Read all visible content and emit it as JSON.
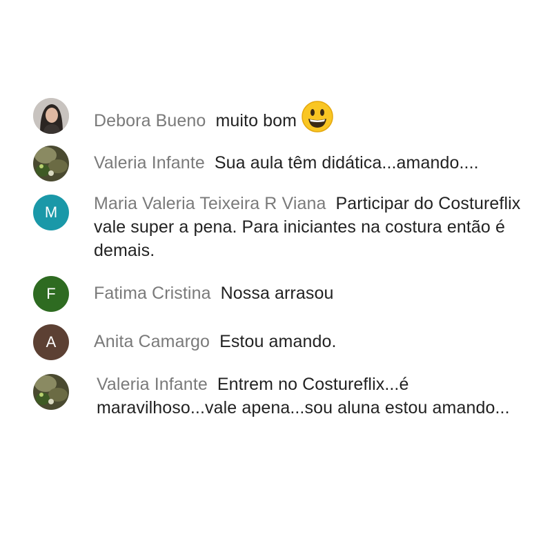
{
  "messages": [
    {
      "author": "Debora Bueno",
      "text": "muito bom",
      "emoji": "grinning-face-emoji"
    },
    {
      "author": "Valeria Infante",
      "text": "Sua aula têm didática...amando...."
    },
    {
      "author": "Maria Valeria Teixeira R Viana",
      "text": "Participar do Costureflix vale super a pena. Para iniciantes na costura então é demais.",
      "avatar_letter": "M",
      "avatar_color": "#1a98a8"
    },
    {
      "author": "Fatima Cristina",
      "text": "Nossa arrasou",
      "avatar_letter": "F",
      "avatar_color": "#2e6b21"
    },
    {
      "author": "Anita Camargo",
      "text": "Estou amando.",
      "avatar_letter": "A",
      "avatar_color": "#5c4033"
    },
    {
      "author": "Valeria Infante",
      "text": "Entrem no Costureflix...é maravilhoso...vale apena...sou aluna estou amando..."
    }
  ]
}
